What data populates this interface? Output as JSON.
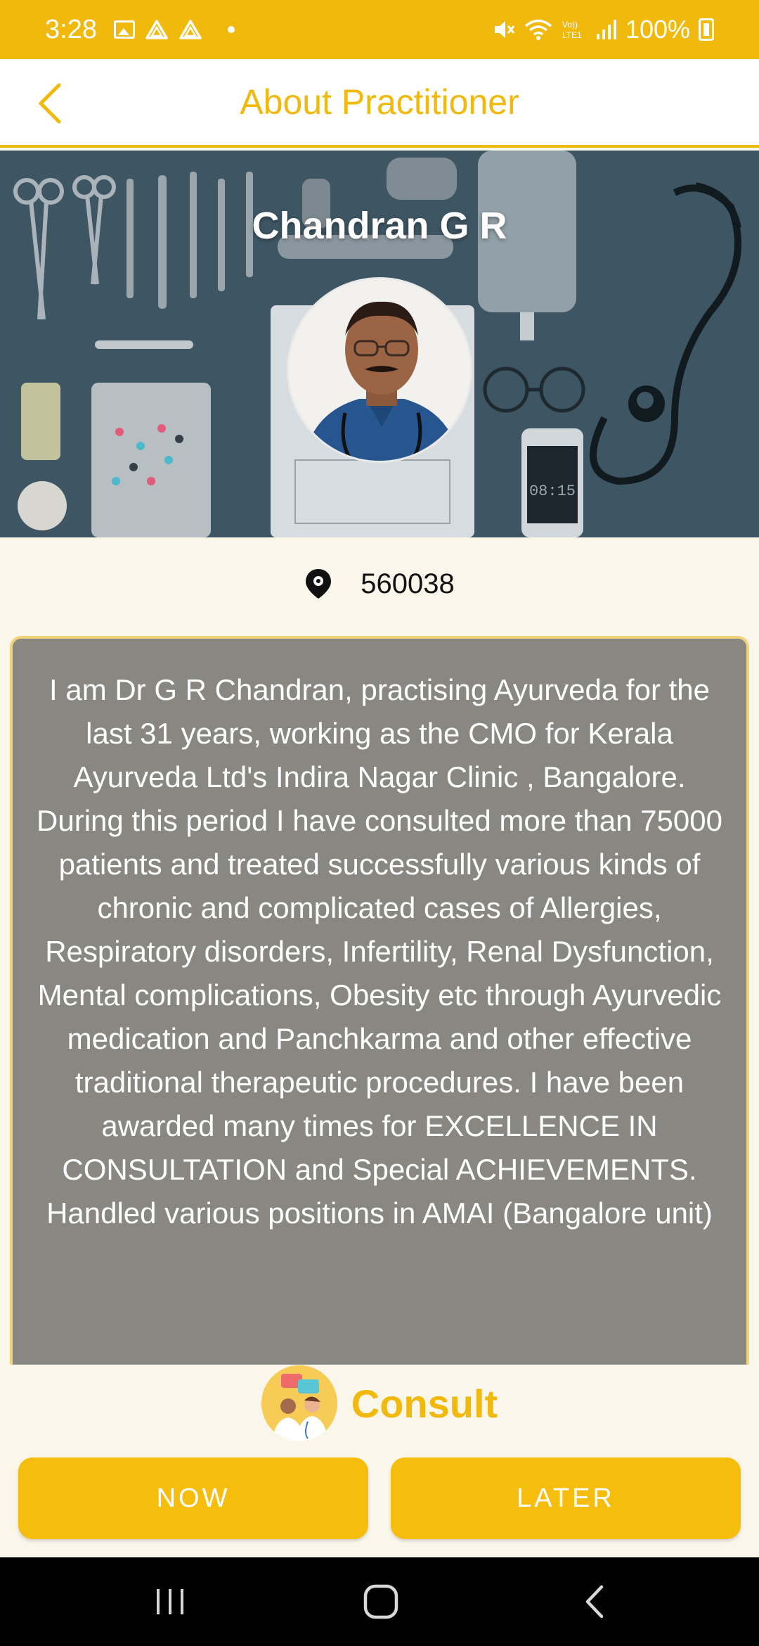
{
  "status_bar": {
    "time": "3:28",
    "battery": "100%"
  },
  "header": {
    "title": "About Practitioner"
  },
  "practitioner": {
    "name": "Chandran G R",
    "pincode": "560038",
    "bio": "I am Dr G R Chandran, practising Ayurveda for the last 31 years, working as the CMO for Kerala Ayurveda Ltd's Indira Nagar Clinic , Bangalore. During this period I have consulted more than 75000 patients and treated successfully various kinds of chronic and complicated cases of Allergies, Respiratory disorders, Infertility, Renal Dysfunction, Mental complications, Obesity etc through Ayurvedic medication and Panchkarma and other effective traditional therapeutic procedures. I have been awarded many times for EXCELLENCE IN CONSULTATION and Special ACHIEVEMENTS. Handled various positions in AMAI (Bangalore unit)"
  },
  "consult": {
    "label": "Consult",
    "now_label": "NOW",
    "later_label": "LATER"
  },
  "theme": {
    "accent": "#f0b90b",
    "bio_bg": "#898782",
    "page_bg": "#fbf6ea"
  },
  "icons": {
    "back": "chevron-left-icon",
    "location": "location-pin-icon",
    "consult": "doctors-chat-icon",
    "nav_recents": "recents-icon",
    "nav_home": "home-icon",
    "nav_back": "back-icon"
  }
}
